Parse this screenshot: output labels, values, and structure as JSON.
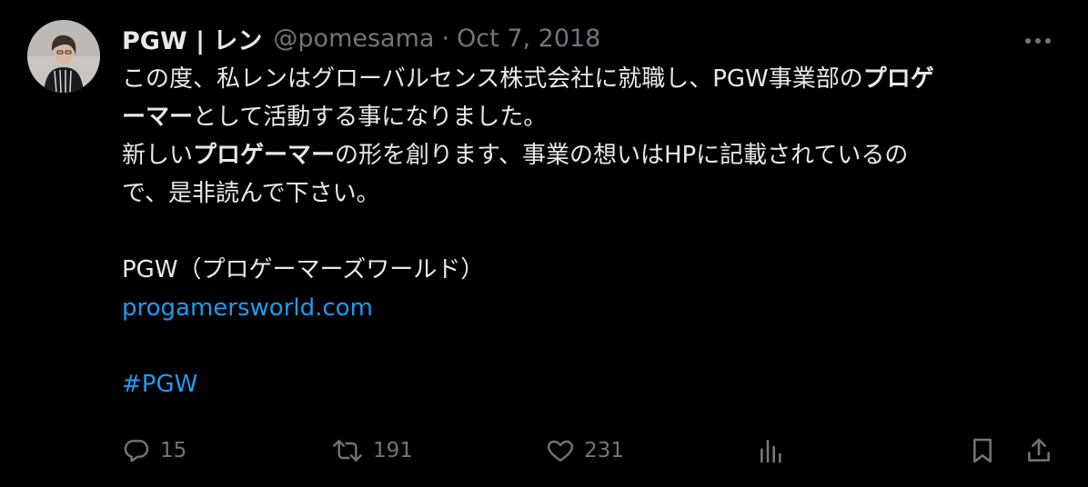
{
  "author": {
    "display_name": "PGW | レン",
    "handle": "@pomesama",
    "separator": "·",
    "date": "Oct 7, 2018"
  },
  "tweet": {
    "line1_prefix": "この度、私レンはグローバルセンス株式会社に就職し、PGW事業部の",
    "line1_bold": "プロゲ",
    "line2_bold": "ーマー",
    "line2_suffix": "として活動する事になりました。",
    "line3_prefix": "新しい",
    "line3_bold": "プロゲーマー",
    "line3_suffix": "の形を創ります、事業の想いはHPに記載されているの",
    "line4": "で、是非読んで下さい。",
    "line5": "PGW（プロゲーマーズワールド）",
    "link": "progamersworld.com",
    "hashtag": "#PGW"
  },
  "actions": {
    "replies": "15",
    "retweets": "191",
    "likes": "231"
  },
  "colors": {
    "background": "#000000",
    "text": "#e7e9ea",
    "muted": "#71767b",
    "link": "#1d9bf0"
  },
  "icons": [
    "more-icon",
    "reply-icon",
    "retweet-icon",
    "like-icon",
    "views-icon",
    "bookmark-icon",
    "share-icon"
  ]
}
